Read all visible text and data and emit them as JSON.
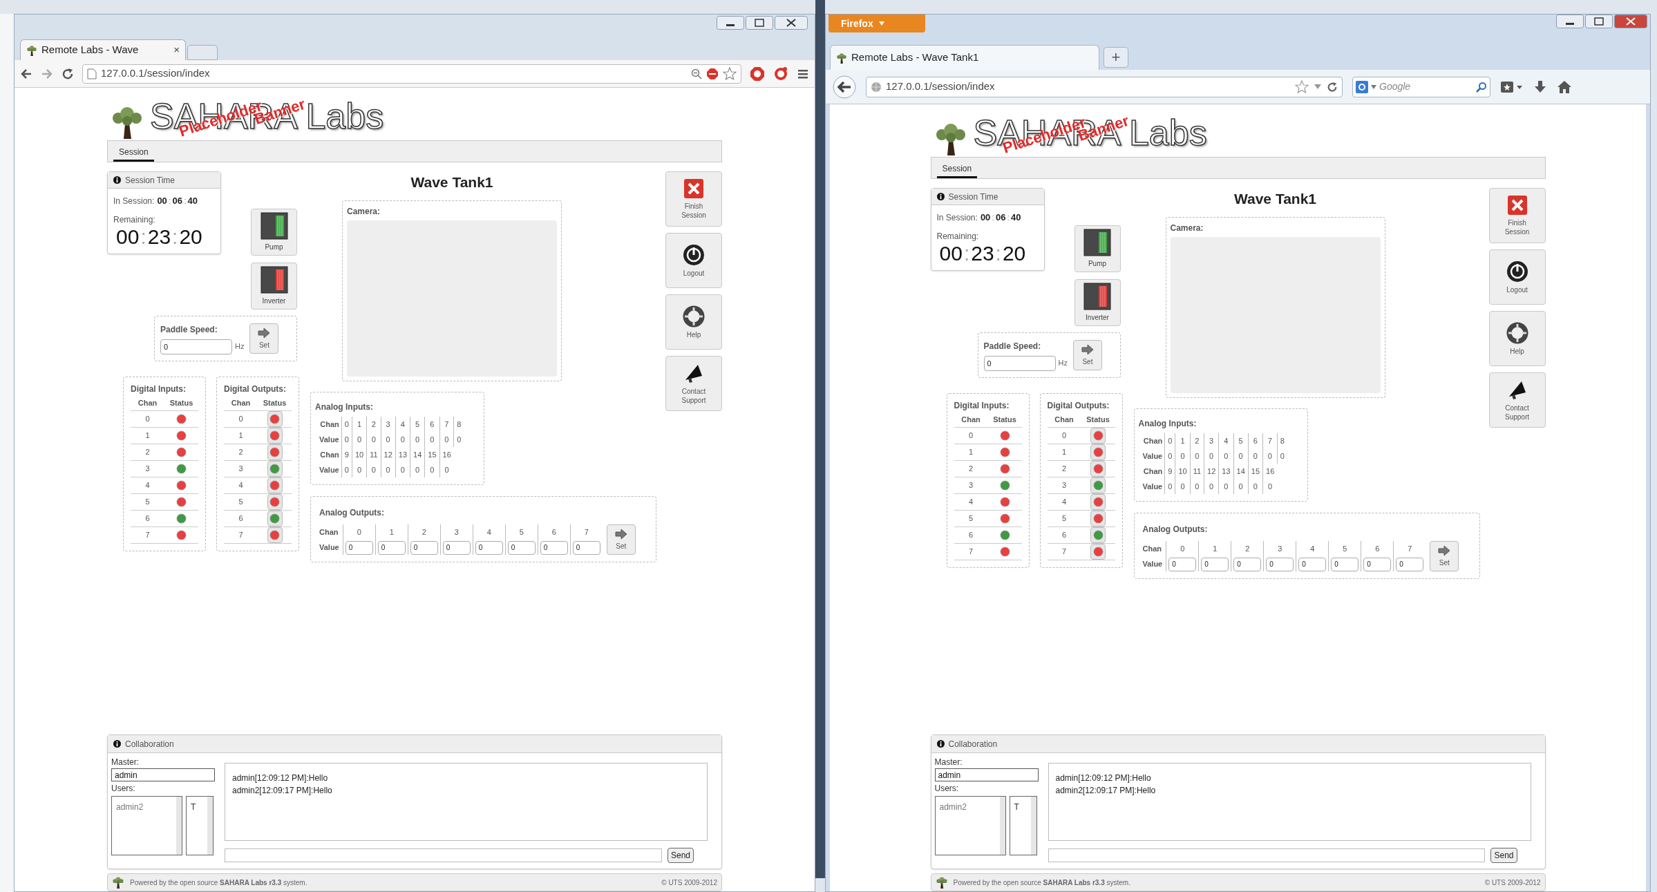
{
  "windows": [
    {
      "kind": "chrome",
      "tab_title": "Remote Labs - Wave",
      "tab_close": "×",
      "url": "127.0.0.1/session/index",
      "page": {
        "logo": {
          "title": "SAHARA Labs",
          "overlay": [
            "Placeholder",
            "Banner"
          ]
        },
        "nav": [
          {
            "label": "Session",
            "selected": true
          }
        ],
        "session_time": {
          "title": "Session Time",
          "in_session_label": "In Session:",
          "in_session": [
            "00",
            ":",
            "06",
            ":",
            "40"
          ],
          "remaining_label": "Remaining:",
          "remaining": [
            "00",
            ":",
            "23",
            ":",
            "20"
          ]
        },
        "switches": [
          {
            "label": "Pump",
            "on": true
          },
          {
            "label": "Inverter",
            "on": false
          }
        ],
        "title": "Wave Tank1",
        "camera_label": "Camera:",
        "paddle": {
          "label": "Paddle Speed:",
          "value": "0",
          "unit": "Hz",
          "button": "Set"
        },
        "digital_inputs": {
          "title": "Digital Inputs:",
          "headers": [
            "Chan",
            "Status"
          ],
          "rows": [
            {
              "chan": "0",
              "on": false
            },
            {
              "chan": "1",
              "on": false
            },
            {
              "chan": "2",
              "on": false
            },
            {
              "chan": "3",
              "on": true
            },
            {
              "chan": "4",
              "on": false
            },
            {
              "chan": "5",
              "on": false
            },
            {
              "chan": "6",
              "on": true
            },
            {
              "chan": "7",
              "on": false
            }
          ]
        },
        "digital_outputs": {
          "title": "Digital Outputs:",
          "headers": [
            "Chan",
            "Status"
          ],
          "rows": [
            {
              "chan": "0",
              "on": false
            },
            {
              "chan": "1",
              "on": false
            },
            {
              "chan": "2",
              "on": false
            },
            {
              "chan": "3",
              "on": true
            },
            {
              "chan": "4",
              "on": false
            },
            {
              "chan": "5",
              "on": false
            },
            {
              "chan": "6",
              "on": true
            },
            {
              "chan": "7",
              "on": false
            }
          ]
        },
        "analog_inputs": {
          "title": "Analog Inputs:",
          "rows": [
            {
              "label": "Chan",
              "cells": [
                "0",
                "1",
                "2",
                "3",
                "4",
                "5",
                "6",
                "7",
                "8"
              ]
            },
            {
              "label": "Value",
              "cells": [
                "0",
                "0",
                "0",
                "0",
                "0",
                "0",
                "0",
                "0",
                "0"
              ]
            },
            {
              "label": "Chan",
              "cells": [
                "9",
                "10",
                "11",
                "12",
                "13",
                "14",
                "15",
                "16"
              ]
            },
            {
              "label": "Value",
              "cells": [
                "0",
                "0",
                "0",
                "0",
                "0",
                "0",
                "0",
                "0"
              ]
            }
          ]
        },
        "analog_outputs": {
          "title": "Analog Outputs:",
          "chan_label": "Chan",
          "value_label": "Value",
          "channels": [
            {
              "chan": "0",
              "value": "0"
            },
            {
              "chan": "1",
              "value": "0"
            },
            {
              "chan": "2",
              "value": "0"
            },
            {
              "chan": "3",
              "value": "0"
            },
            {
              "chan": "4",
              "value": "0"
            },
            {
              "chan": "5",
              "value": "0"
            },
            {
              "chan": "6",
              "value": "0"
            },
            {
              "chan": "7",
              "value": "0"
            }
          ],
          "button": "Set"
        },
        "actions": [
          {
            "kind": "finish",
            "label": "Finish Session"
          },
          {
            "kind": "logout",
            "label": "Logout"
          },
          {
            "kind": "help",
            "label": "Help"
          },
          {
            "kind": "contact",
            "label": "Contact Support"
          }
        ],
        "collaboration": {
          "title": "Collaboration",
          "master_label": "Master:",
          "master": "admin",
          "users_label": "Users:",
          "users": [
            "admin2"
          ],
          "flags": [
            "T"
          ],
          "messages": [
            "admin[12:09:12 PM]:Hello",
            "admin2[12:09:17 PM]:Hello"
          ],
          "send": "Send"
        },
        "footer": {
          "text": "Powered by the open source **SAHARA Labs r3.3** system.",
          "copyright": "© UTS 2009-2012"
        }
      }
    },
    {
      "kind": "firefox",
      "menu_button": "Firefox",
      "tab_title": "Remote Labs - Wave Tank1",
      "new_tab": "+",
      "url": "127.0.0.1/session/index",
      "search_placeholder": "Google",
      "page": {
        "logo": {
          "title": "SAHARA Labs",
          "overlay": [
            "Placeholder",
            "Banner"
          ]
        },
        "nav": [
          {
            "label": "Session",
            "selected": true
          }
        ],
        "session_time": {
          "title": "Session Time",
          "in_session_label": "In Session:",
          "in_session": [
            "00",
            ":",
            "06",
            ":",
            "40"
          ],
          "remaining_label": "Remaining:",
          "remaining": [
            "00",
            ":",
            "23",
            ":",
            "20"
          ]
        },
        "switches": [
          {
            "label": "Pump",
            "on": true
          },
          {
            "label": "Inverter",
            "on": false
          }
        ],
        "title": "Wave Tank1",
        "camera_label": "Camera:",
        "paddle": {
          "label": "Paddle Speed:",
          "value": "0",
          "unit": "Hz",
          "button": "Set"
        },
        "digital_inputs": {
          "title": "Digital Inputs:",
          "headers": [
            "Chan",
            "Status"
          ],
          "rows": [
            {
              "chan": "0",
              "on": false
            },
            {
              "chan": "1",
              "on": false
            },
            {
              "chan": "2",
              "on": false
            },
            {
              "chan": "3",
              "on": true
            },
            {
              "chan": "4",
              "on": false
            },
            {
              "chan": "5",
              "on": false
            },
            {
              "chan": "6",
              "on": true
            },
            {
              "chan": "7",
              "on": false
            }
          ]
        },
        "digital_outputs": {
          "title": "Digital Outputs:",
          "headers": [
            "Chan",
            "Status"
          ],
          "rows": [
            {
              "chan": "0",
              "on": false
            },
            {
              "chan": "1",
              "on": false
            },
            {
              "chan": "2",
              "on": false
            },
            {
              "chan": "3",
              "on": true
            },
            {
              "chan": "4",
              "on": false
            },
            {
              "chan": "5",
              "on": false
            },
            {
              "chan": "6",
              "on": true
            },
            {
              "chan": "7",
              "on": false
            }
          ]
        },
        "analog_inputs": {
          "title": "Analog Inputs:",
          "rows": [
            {
              "label": "Chan",
              "cells": [
                "0",
                "1",
                "2",
                "3",
                "4",
                "5",
                "6",
                "7",
                "8"
              ]
            },
            {
              "label": "Value",
              "cells": [
                "0",
                "0",
                "0",
                "0",
                "0",
                "0",
                "0",
                "0",
                "0"
              ]
            },
            {
              "label": "Chan",
              "cells": [
                "9",
                "10",
                "11",
                "12",
                "13",
                "14",
                "15",
                "16"
              ]
            },
            {
              "label": "Value",
              "cells": [
                "0",
                "0",
                "0",
                "0",
                "0",
                "0",
                "0",
                "0"
              ]
            }
          ]
        },
        "analog_outputs": {
          "title": "Analog Outputs:",
          "chan_label": "Chan",
          "value_label": "Value",
          "channels": [
            {
              "chan": "0",
              "value": "0"
            },
            {
              "chan": "1",
              "value": "0"
            },
            {
              "chan": "2",
              "value": "0"
            },
            {
              "chan": "3",
              "value": "0"
            },
            {
              "chan": "4",
              "value": "0"
            },
            {
              "chan": "5",
              "value": "0"
            },
            {
              "chan": "6",
              "value": "0"
            },
            {
              "chan": "7",
              "value": "0"
            }
          ],
          "button": "Set"
        },
        "actions": [
          {
            "kind": "finish",
            "label": "Finish Session"
          },
          {
            "kind": "logout",
            "label": "Logout"
          },
          {
            "kind": "help",
            "label": "Help"
          },
          {
            "kind": "contact",
            "label": "Contact Support"
          }
        ],
        "collaboration": {
          "title": "Collaboration",
          "master_label": "Master:",
          "master": "admin",
          "users_label": "Users:",
          "users": [
            "admin2"
          ],
          "flags": [
            "T"
          ],
          "messages": [
            "admin[12:09:12 PM]:Hello",
            "admin2[12:09:17 PM]:Hello"
          ],
          "send": "Send"
        },
        "footer": {
          "text": "Powered by the open source **SAHARA Labs r3.3** system.",
          "copyright": "© UTS 2009-2012"
        }
      }
    }
  ]
}
